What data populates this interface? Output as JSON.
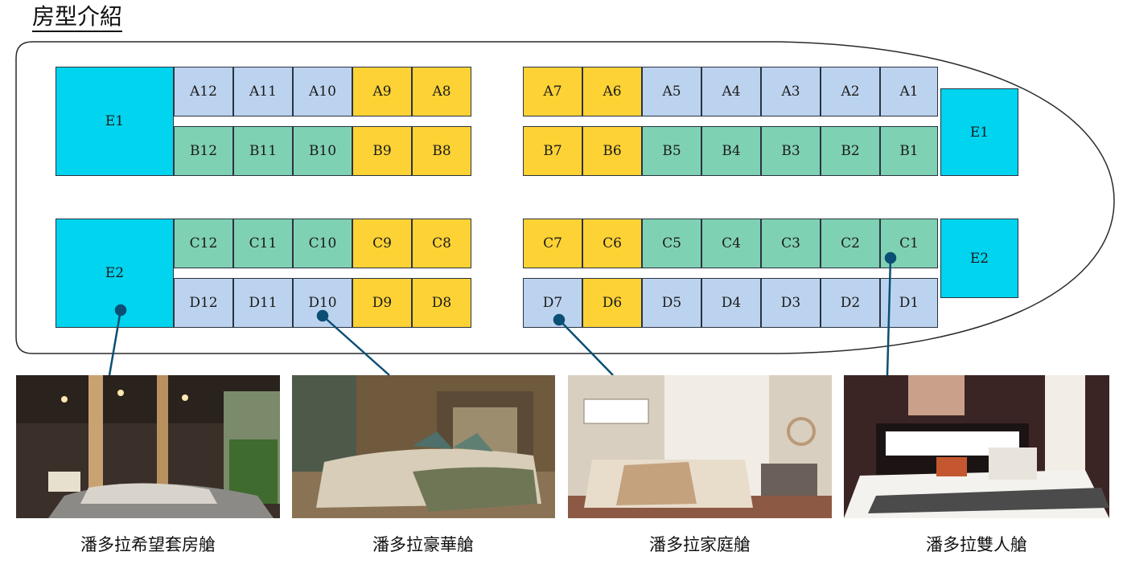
{
  "page": {
    "title": "房型介紹"
  },
  "rooms": {
    "left_block": {
      "e_top": "E1",
      "row_a": [
        "A12",
        "A11",
        "A10",
        "A9",
        "A8"
      ],
      "row_b": [
        "B12",
        "B11",
        "B10",
        "B9",
        "B8"
      ],
      "e_bottom": "E2",
      "row_c": [
        "C12",
        "C11",
        "C10",
        "C9",
        "C8"
      ],
      "row_d": [
        "D12",
        "D11",
        "D10",
        "D9",
        "D8"
      ]
    },
    "right_block": {
      "row_a": [
        "A7",
        "A6",
        "A5",
        "A4",
        "A3",
        "A2",
        "A1"
      ],
      "row_b": [
        "B7",
        "B6",
        "B5",
        "B4",
        "B3",
        "B2",
        "B1"
      ],
      "e_top": "E1",
      "row_c": [
        "C7",
        "C6",
        "C5",
        "C4",
        "C3",
        "C2",
        "C1"
      ],
      "row_d": [
        "D7",
        "D6",
        "D5",
        "D4",
        "D3",
        "D2",
        "D1"
      ],
      "e_bottom": "E2"
    }
  },
  "colors": {
    "blue": "#bcd3ef",
    "green": "#7fd1b4",
    "yellow": "#fdd235",
    "cyan": "#00d4ef",
    "pointer": "#0b4f74"
  },
  "room_types": [
    {
      "caption": "潘多拉希望套房艙"
    },
    {
      "caption": "潘多拉豪華艙"
    },
    {
      "caption": "潘多拉家庭艙"
    },
    {
      "caption": "潘多拉雙人艙"
    }
  ]
}
